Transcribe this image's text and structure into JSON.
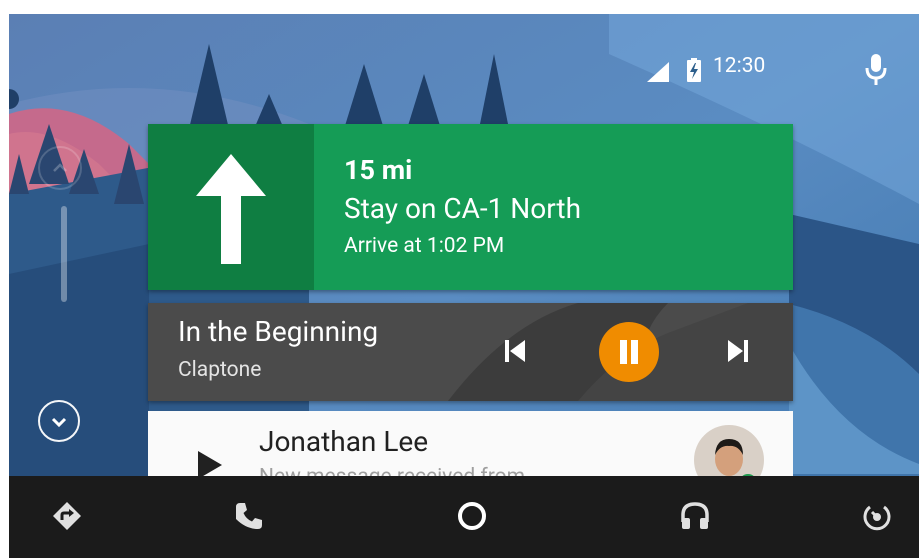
{
  "status_bar": {
    "time": "12:30",
    "signal_icon": "cell-signal-icon",
    "battery_icon": "battery-charging-icon",
    "mic_icon": "microphone-icon"
  },
  "scroll": {
    "up_icon": "chevron-up-icon",
    "down_icon": "chevron-down-icon"
  },
  "navigation": {
    "distance": "15 mi",
    "instruction": "Stay on CA-1 North",
    "arrival": "Arrive at 1:02 PM",
    "direction_icon": "arrow-up-icon",
    "color": "#159c56"
  },
  "media": {
    "title": "In the Beginning",
    "artist": "Claptone",
    "state": "playing",
    "accent": "#f08c00"
  },
  "message": {
    "contact": "Jonathan Lee",
    "preview": "New message received from"
  },
  "bottom_nav": [
    {
      "name": "navigation",
      "icon": "navigation-icon"
    },
    {
      "name": "phone",
      "icon": "phone-icon"
    },
    {
      "name": "home",
      "icon": "home-circle-icon"
    },
    {
      "name": "media",
      "icon": "headphones-icon"
    },
    {
      "name": "exit",
      "icon": "exit-icon"
    }
  ]
}
